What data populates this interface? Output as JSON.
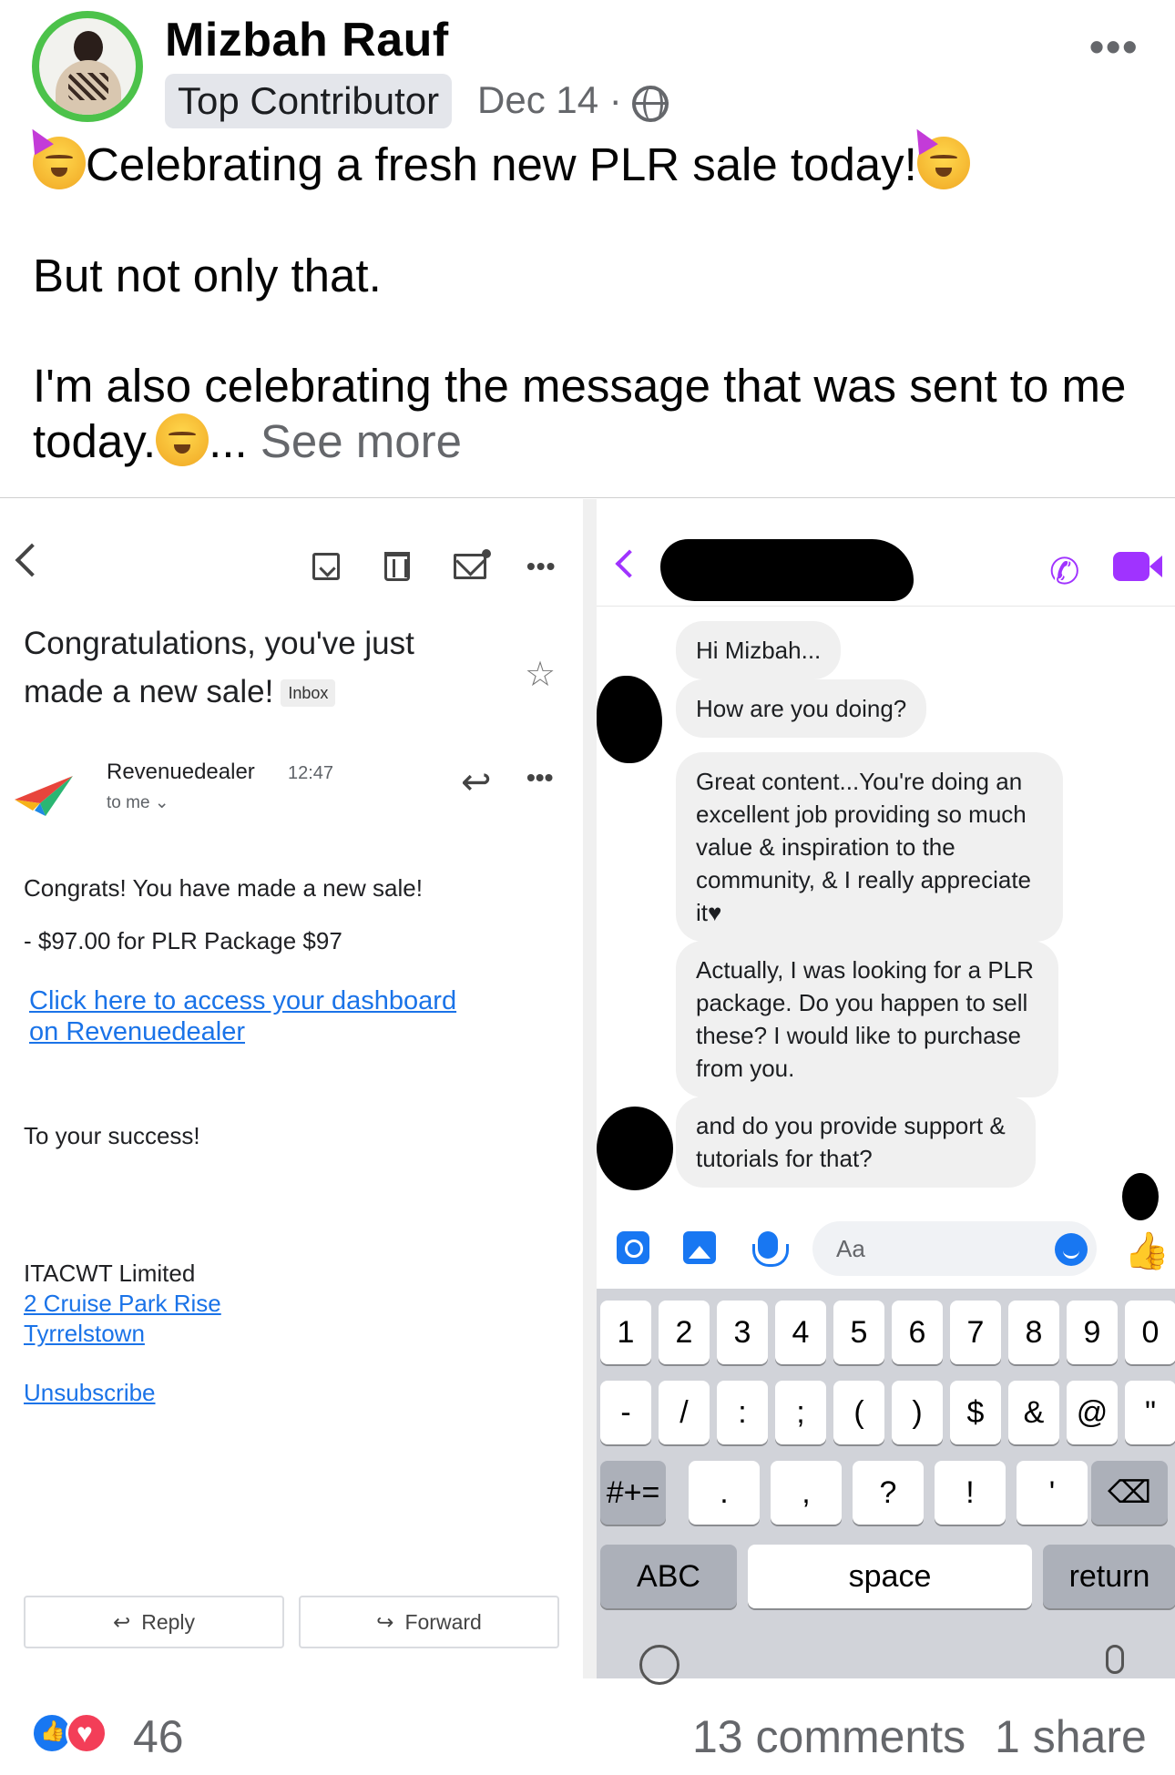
{
  "post": {
    "author": "Mizbah Rauf",
    "badge": "Top Contributor",
    "date": "Dec 14 ·",
    "line1": "Celebrating a fresh new PLR sale today!",
    "line2": "But not only that.",
    "line3": "I'm also celebrating the message that was sent to me",
    "line4": "today.",
    "ellipsis": "...",
    "see_more": "See more"
  },
  "email": {
    "subject": "Congratulations, you've just made a new sale!",
    "inbox_tag": "Inbox",
    "sender": "Revenuedealer",
    "time": "12:47",
    "to": "to me ⌄",
    "body1": "Congrats! You have made a new sale!",
    "body2": "- $97.00 for PLR Package $97",
    "link1": "Click here to access your dashboard",
    "link2": "on Revenuedealer",
    "closing": "To your success!",
    "company": "ITACWT Limited",
    "address1": "2 Cruise Park Rise",
    "address2": "Tyrrelstown",
    "unsubscribe": "Unsubscribe",
    "reply": "Reply",
    "forward": "Forward"
  },
  "messenger": {
    "messages": [
      "Hi Mizbah...",
      "How are you doing?",
      "Great content...You're doing an excellent job providing so much value & inspiration to the community, & I really appreciate it♥",
      "Actually, I was looking for a PLR package. Do you happen to sell these? I would like to purchase from you.",
      "and do you provide support & tutorials for that?"
    ],
    "input_placeholder": "Aa"
  },
  "keyboard": {
    "row1": [
      "1",
      "2",
      "3",
      "4",
      "5",
      "6",
      "7",
      "8",
      "9",
      "0"
    ],
    "row2": [
      "-",
      "/",
      ":",
      ";",
      "(",
      ")",
      "$",
      "&",
      "@",
      "\""
    ],
    "row3": [
      "#+=",
      ".",
      ",",
      "?",
      "!",
      "'",
      "⌫"
    ],
    "abc": "ABC",
    "space": "space",
    "return": "return"
  },
  "footer": {
    "reactions": "46",
    "comments": "13 comments",
    "shares": "1 share"
  },
  "colors": {
    "messenger_accent": "#a033ff",
    "link_blue": "#1a73e8",
    "fb_blue": "#1877f2"
  }
}
